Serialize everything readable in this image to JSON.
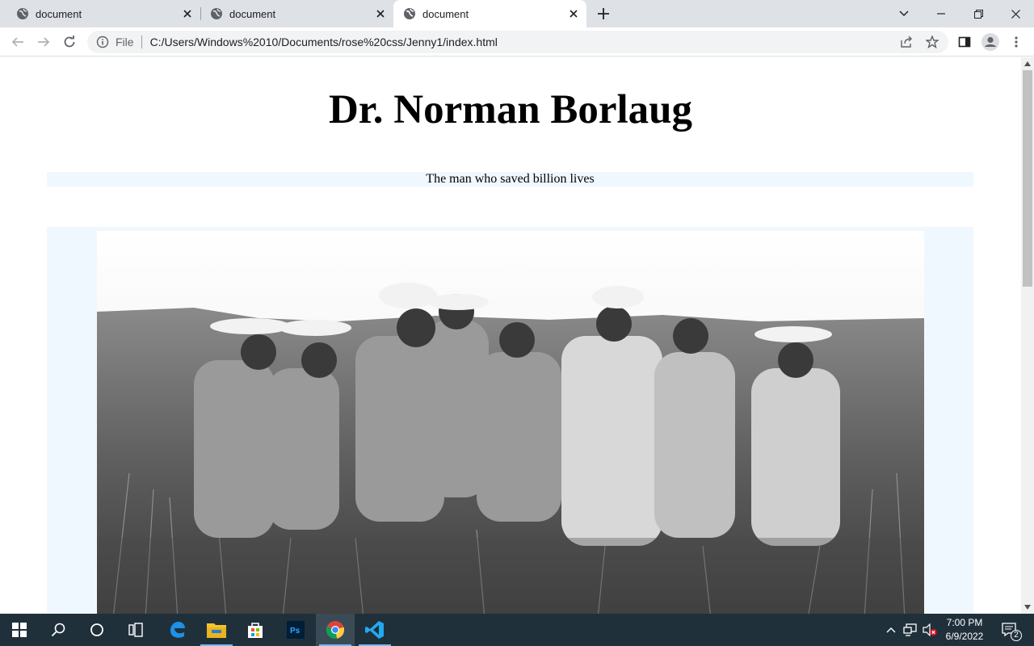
{
  "tabs": [
    {
      "label": "document"
    },
    {
      "label": "document"
    },
    {
      "label": "document"
    }
  ],
  "address": {
    "scheme_label": "File",
    "url": "C:/Users/Windows%2010/Documents/rose%20css/Jenny1/index.html"
  },
  "page": {
    "heading": "Dr. Norman Borlaug",
    "tagline": "The man who saved billion lives"
  },
  "clock": {
    "time": "7:00 PM",
    "date": "6/9/2022"
  },
  "notifications": {
    "count": "2"
  },
  "colors": {
    "tabstrip_bg": "#dee1e6",
    "tagline_bg": "#f0f8ff",
    "taskbar_bg": "#20303b"
  }
}
